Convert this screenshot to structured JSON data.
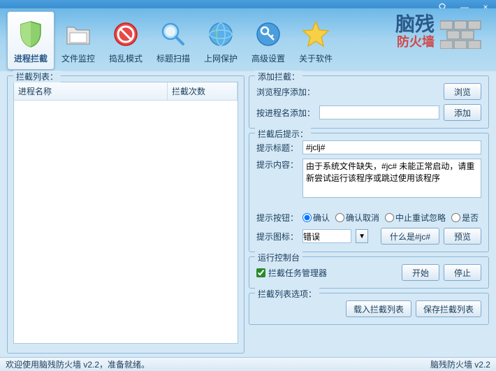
{
  "titlebar": {
    "help": "?",
    "min": "—",
    "close": "×"
  },
  "toolbar": {
    "items": [
      {
        "label": "进程拦截"
      },
      {
        "label": "文件监控"
      },
      {
        "label": "捣乱模式"
      },
      {
        "label": "标题扫描"
      },
      {
        "label": "上网保护"
      },
      {
        "label": "高级设置"
      },
      {
        "label": "关于软件"
      }
    ]
  },
  "brand": {
    "title": "脑残",
    "sub": "防火墙"
  },
  "left": {
    "legend": "拦截列表：",
    "col1": "进程名称",
    "col2": "拦截次数"
  },
  "add": {
    "legend": "添加拦截：",
    "browse_label": "浏览程序添加：",
    "browse_btn": "浏览",
    "byname_label": "按进程名添加：",
    "byname_value": "",
    "add_btn": "添加"
  },
  "tip": {
    "legend": "拦截后提示：",
    "title_label": "提示标题：",
    "title_value": "#jclj#",
    "content_label": "提示内容：",
    "content_value": "由于系统文件缺失，#jc# 未能正常启动，请重新尝试运行该程序或跳过使用该程序",
    "button_label": "提示按钮：",
    "radios": [
      "确认",
      "确认取消",
      "中止重试忽略",
      "是否"
    ],
    "icon_label": "提示图标：",
    "icon_value": "错误",
    "whatis_btn": "什么是#jc#",
    "preview_btn": "预览"
  },
  "runtime": {
    "legend": "运行控制台",
    "taskmgr": "拦截任务管理器",
    "taskmgr_checked": true,
    "start_btn": "开始",
    "stop_btn": "停止"
  },
  "listops": {
    "legend": "拦截列表选项：",
    "load_btn": "载入拦截列表",
    "save_btn": "保存拦截列表"
  },
  "status": {
    "left": "欢迎使用脑残防火墙 v2.2，准备就绪。",
    "right": "脑残防火墙 v2.2"
  }
}
